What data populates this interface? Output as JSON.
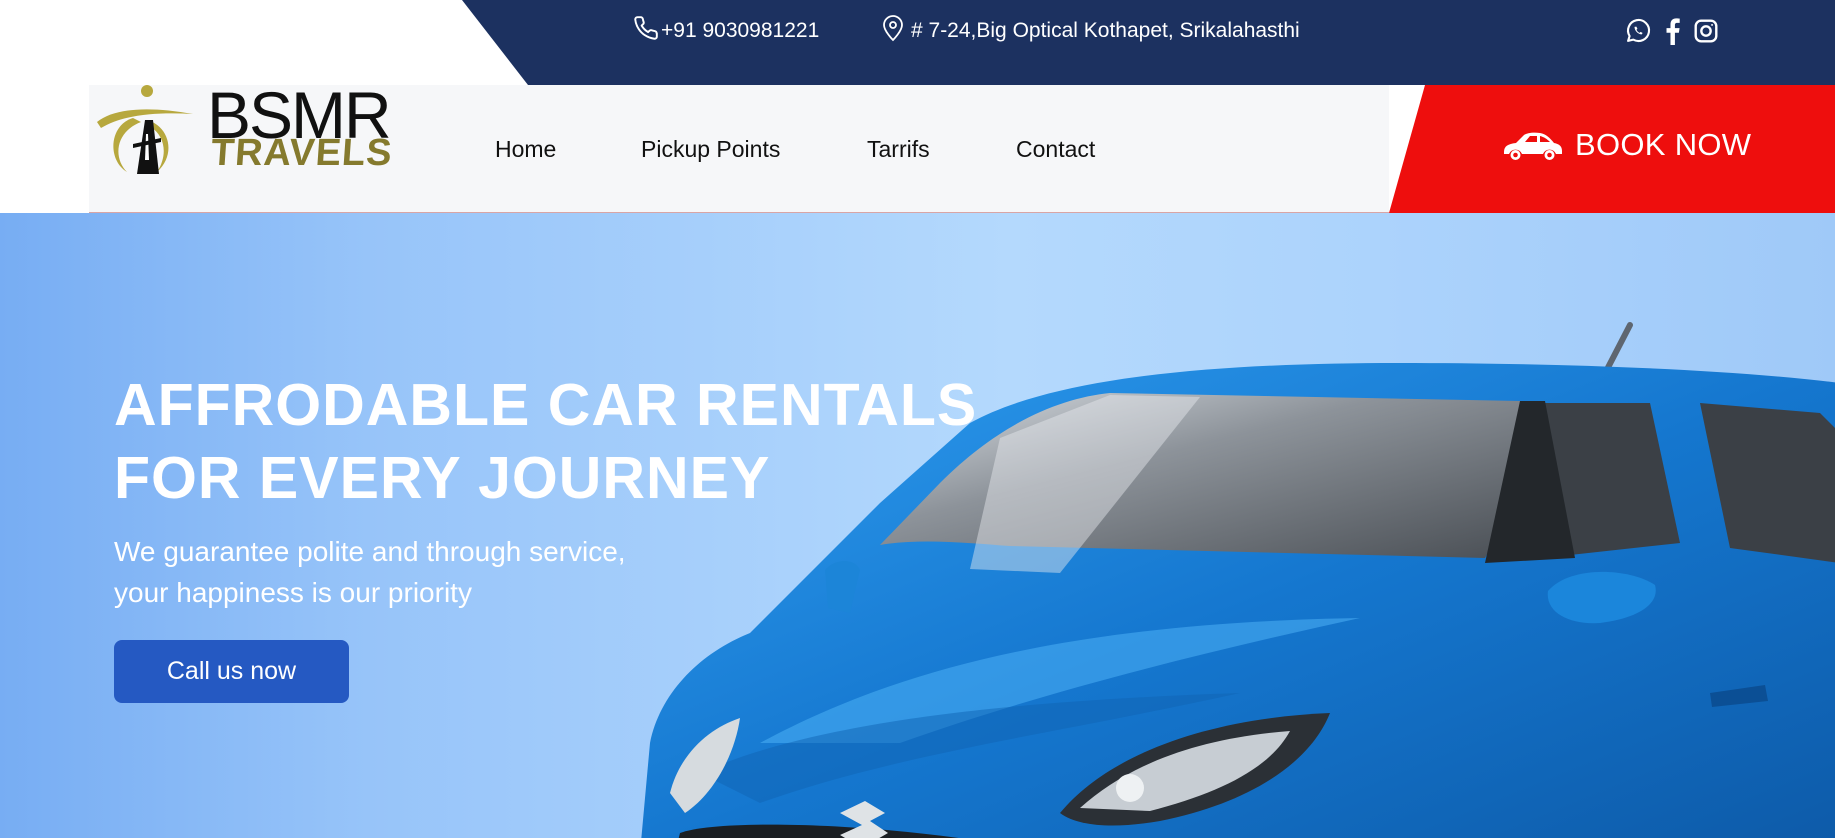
{
  "topbar": {
    "phone": "+91 9030981221",
    "address": "# 7-24,Big Optical Kothapet, Srikalahasthi",
    "icons": [
      "phone-icon",
      "location-pin-icon",
      "whatsapp-icon",
      "facebook-icon",
      "instagram-icon"
    ]
  },
  "logo": {
    "line1": "BSMR",
    "line2": "TRAVELS"
  },
  "nav": {
    "items": [
      "Home",
      "Pickup Points",
      "Tarrifs",
      "Contact"
    ]
  },
  "book_now": {
    "label": "BOOK NOW",
    "icon": "car-icon"
  },
  "hero": {
    "title_line1": "AFFRODABLE CAR RENTALS",
    "title_line2": "FOR EVERY JOURNEY",
    "subtitle_line1": "We guarantee polite and through service,",
    "subtitle_line2": "your happiness is our priority",
    "cta_label": "Call us now"
  },
  "colors": {
    "topbar_bg": "#1c3160",
    "book_bg": "#ee0e0d",
    "cta_bg": "#2559c2",
    "logo_gold": "#857a2e",
    "car_blue": "#1a7fd6"
  }
}
